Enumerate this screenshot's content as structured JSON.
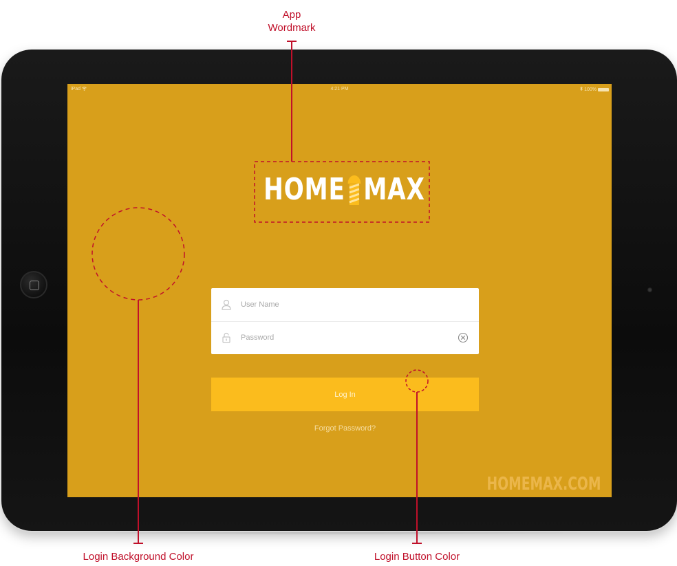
{
  "status_bar": {
    "device": "iPad",
    "wifi_icon": "wifi-icon",
    "time": "4:21 PM",
    "bluetooth_icon": "bluetooth-icon",
    "battery_percent": "100%"
  },
  "app": {
    "wordmark": {
      "left": "HOME",
      "right": "MAX",
      "pole_icon": "barber-pole-icon"
    },
    "username_placeholder": "User Name",
    "password_placeholder": "Password",
    "login_label": "Log In",
    "forgot_label": "Forgot Password?",
    "site_url": "HOMEMAX.COM"
  },
  "colors": {
    "background": "#D89F1B",
    "button": "#FBBC1D",
    "annotation": "#C0102A"
  },
  "annotations": {
    "wordmark_label_line1": "App",
    "wordmark_label_line2": "Wordmark",
    "background_label": "Login Background Color",
    "button_label": "Login Button Color"
  }
}
